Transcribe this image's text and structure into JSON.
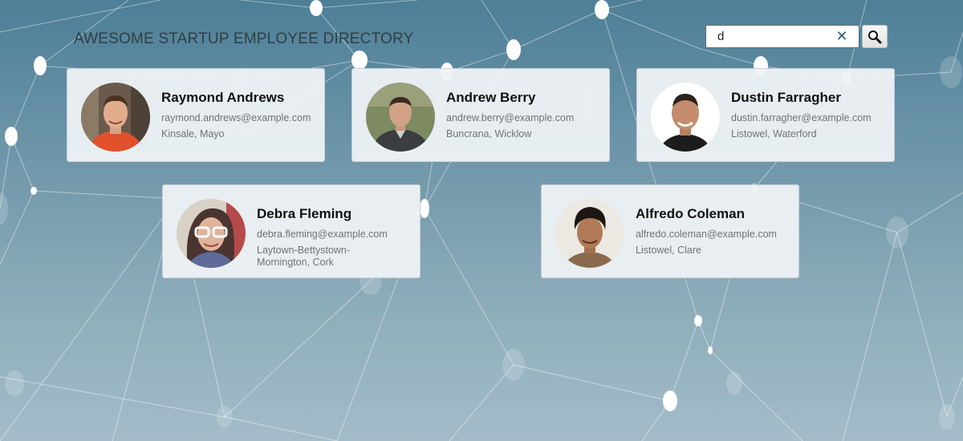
{
  "header": {
    "title": "AWESOME STARTUP EMPLOYEE DIRECTORY"
  },
  "search": {
    "value": "d",
    "placeholder": "",
    "clear_icon": "close-icon",
    "button_icon": "search-icon"
  },
  "employees": [
    {
      "name": "Raymond Andrews",
      "email": "raymond.andrews@example.com",
      "location": "Kinsale, Mayo"
    },
    {
      "name": "Andrew Berry",
      "email": "andrew.berry@example.com",
      "location": "Buncrana, Wicklow"
    },
    {
      "name": "Dustin Farragher",
      "email": "dustin.farragher@example.com",
      "location": "Listowel, Waterford"
    },
    {
      "name": "Debra Fleming",
      "email": "debra.fleming@example.com",
      "location": "Laytown-Bettystown-Mornington, Cork"
    },
    {
      "name": "Alfredo Coleman",
      "email": "alfredo.coleman@example.com",
      "location": "Listowel, Clare"
    }
  ],
  "colors": {
    "background_top": "#4d7f97",
    "background_bottom": "#a3bcc8",
    "card_background": "#eef2f4",
    "clear_icon": "#2e5e86"
  }
}
